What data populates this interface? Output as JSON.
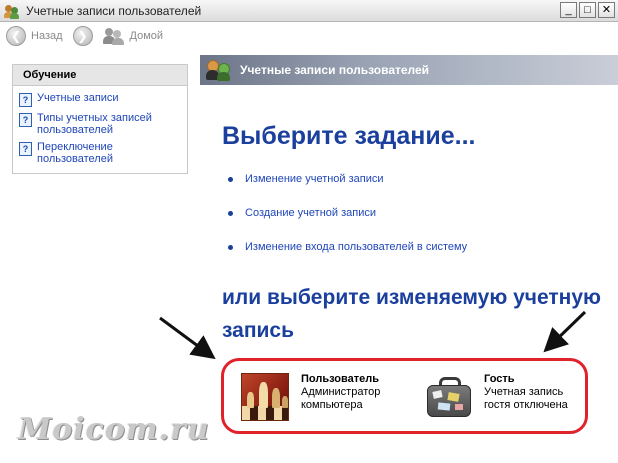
{
  "window": {
    "title": "Учетные записи пользователей",
    "controls": {
      "minimize": "_",
      "maximize": "□",
      "close": "✕"
    }
  },
  "toolbar": {
    "back_label": "Назад",
    "home_label": "Домой"
  },
  "sidebar": {
    "header": "Обучение",
    "items": [
      {
        "label": "Учетные записи"
      },
      {
        "label": "Типы учетных записей пользователей"
      },
      {
        "label": "Переключение пользователей"
      }
    ]
  },
  "content": {
    "header_title": "Учетные записи пользователей",
    "task_heading": "Выберите задание...",
    "tasks": [
      {
        "label": "Изменение учетной записи"
      },
      {
        "label": "Создание учетной записи"
      },
      {
        "label": "Изменение входа пользователей в систему"
      }
    ],
    "pick_heading": "или выберите изменяемую учетную запись",
    "accounts": [
      {
        "name": "Пользователь",
        "desc": "Администратор компьютера",
        "icon": "chess-pieces-icon"
      },
      {
        "name": "Гость",
        "desc": "Учетная запись гостя отключена",
        "icon": "suitcase-icon"
      }
    ]
  },
  "watermark": "Moicom.ru",
  "colors": {
    "link": "#1f46b8",
    "heading": "#1a3f9c",
    "highlight_ring": "#e0222a"
  }
}
